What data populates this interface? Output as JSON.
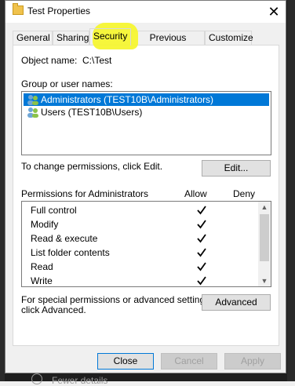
{
  "window": {
    "title": "Test Properties"
  },
  "tabs": [
    {
      "label": "General"
    },
    {
      "label": "Sharing"
    },
    {
      "label": "Security"
    },
    {
      "label": "Previous Versions"
    },
    {
      "label": "Customize"
    }
  ],
  "security": {
    "object_name_label": "Object name:",
    "object_name_value": "C:\\Test",
    "group_label": "Group or user names:",
    "users": [
      {
        "name": "Administrators (TEST10B\\Administrators)",
        "selected": true
      },
      {
        "name": "Users (TEST10B\\Users)",
        "selected": false
      }
    ],
    "change_text": "To change permissions, click Edit.",
    "edit_button": "Edit...",
    "permissions_for": "Permissions for Administrators",
    "allow_header": "Allow",
    "deny_header": "Deny",
    "permissions": [
      {
        "name": "Full control",
        "allow": true
      },
      {
        "name": "Modify",
        "allow": true
      },
      {
        "name": "Read & execute",
        "allow": true
      },
      {
        "name": "List folder contents",
        "allow": true
      },
      {
        "name": "Read",
        "allow": true
      },
      {
        "name": "Write",
        "allow": true
      }
    ],
    "special_text_1": "For special permissions or advanced settings,",
    "special_text_2": "click Advanced.",
    "advanced_button": "Advanced"
  },
  "footer": {
    "close": "Close",
    "cancel": "Cancel",
    "apply": "Apply"
  },
  "background": {
    "partial_text": "Fewer details"
  },
  "colors": {
    "selection": "#0078d7",
    "highlight": "#f5f532"
  }
}
